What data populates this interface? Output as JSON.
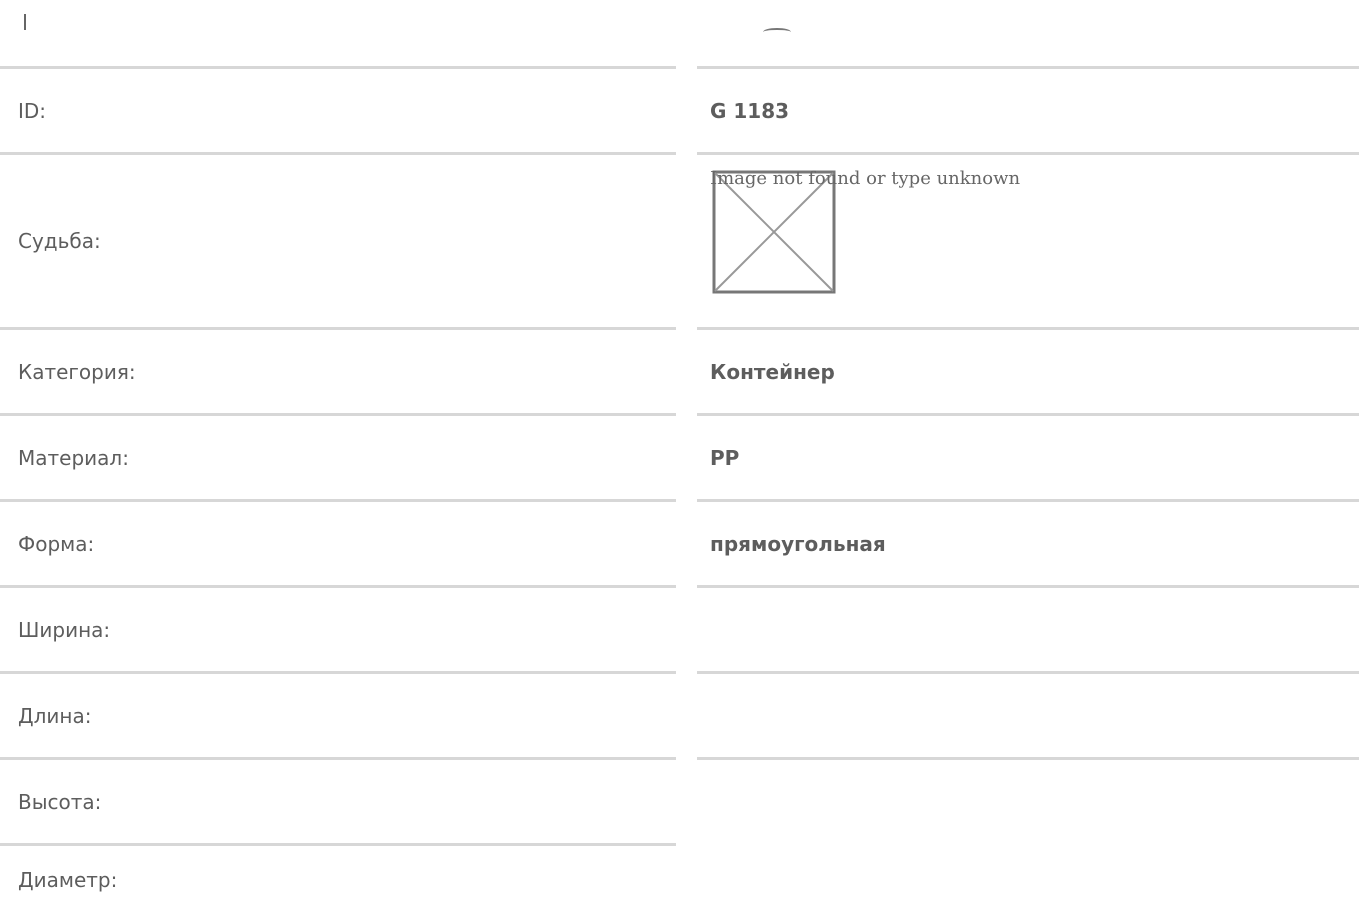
{
  "rows": [
    {
      "label": "ID:",
      "value": "G 1183"
    },
    {
      "label": "Судьба:",
      "image_alt": "Image not found or type unknown"
    },
    {
      "label": "Категория:",
      "value": "Контейнер"
    },
    {
      "label": "Материал:",
      "value": "PP"
    },
    {
      "label": "Форма:",
      "value": "прямоугольная"
    },
    {
      "label": "Ширина:",
      "value": ""
    },
    {
      "label": "Длина:",
      "value": ""
    },
    {
      "label": "Высота:",
      "value": ""
    },
    {
      "label": "Диаметр:",
      "value": ""
    }
  ]
}
